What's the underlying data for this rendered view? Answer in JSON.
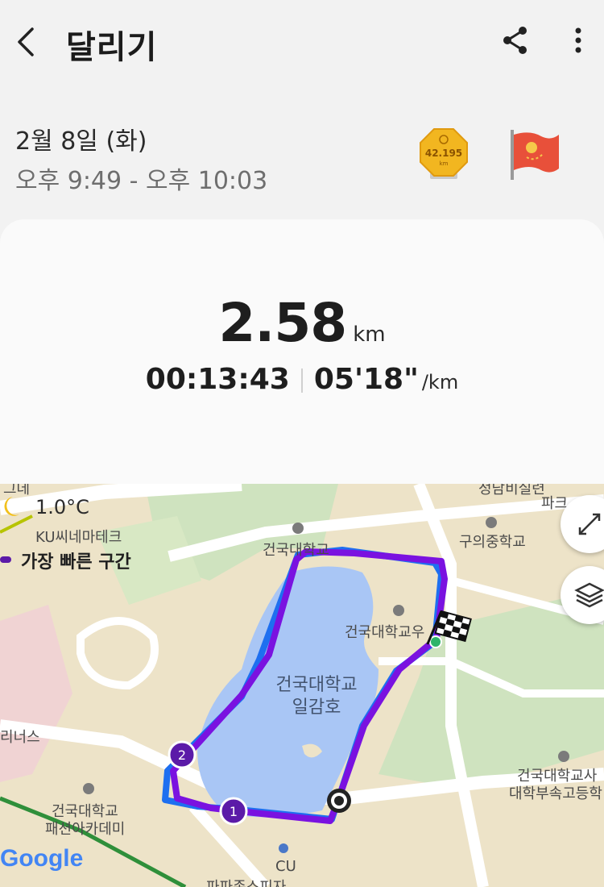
{
  "app": {
    "title": "달리기"
  },
  "workout": {
    "date": "2월 8일 (화)",
    "time_range": "오후 9:49 - 오후 10:03",
    "badge_marathon_text": "42.195",
    "badge_marathon_sub": "km",
    "distance_value": "2.58",
    "distance_unit": "km",
    "duration": "00:13:43",
    "pace": "05'18\"",
    "pace_unit": "/km"
  },
  "map": {
    "weather_temp": "1.0°C",
    "fastest_segment_label": "가장 빠른 구간",
    "labels": {
      "ku_mart": "KU씨네마테크",
      "konkuk_school_top": "건국대학교",
      "konkuk_staff": "건국대학교우",
      "lake_line1": "건국대학교",
      "lake_line2": "일감호",
      "guui_middle": "구의중학교",
      "konkuk_academy1": "건국대학교",
      "konkuk_academy2": "패션아카데미",
      "konkuk_high1": "건국대학교사",
      "konkuk_high2": "대학부속고등학",
      "lioness": "리너스",
      "cu_store": "CU",
      "pizza": "파파존스피자",
      "top_partial1": "정담비실련",
      "top_partial2": "파크",
      "top_left_partial": "그데",
      "google": "Google"
    },
    "markers": {
      "m1": "1",
      "m2": "2"
    }
  },
  "colors": {
    "route_purple": "#7a12e0",
    "route_blue": "#1e6ff0",
    "lake": "#a9c6f5"
  }
}
